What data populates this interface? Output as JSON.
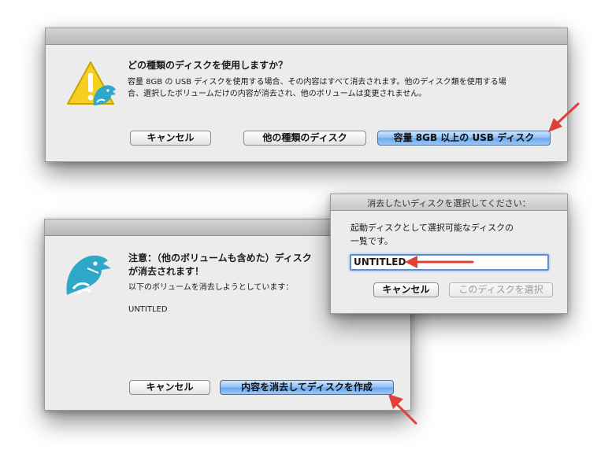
{
  "dialog1": {
    "heading": "どの種類のディスクを使用しますか？",
    "message_line1": "容量 8GB の USB ディスクを使用する場合、その内容はすべて消去されます。他のディスク類を使用する場",
    "message_line2": "合、選択したボリュームだけの内容が消去され、他のボリュームは変更されません。",
    "cancel_label": "キャンセル",
    "other_disk_label": "他の種類のディスク",
    "usb_label": "容量 8GB 以上の USB ディスク"
  },
  "dialog2": {
    "heading_line1": "注意：（他のボリュームも含めた）ディスク",
    "heading_line2": "が消去されます！",
    "message": "以下のボリュームを消去しようとしています：",
    "volume_name": "UNTITLED",
    "cancel_label": "キャンセル",
    "erase_create_label": "内容を消去してディスクを作成"
  },
  "dialog3": {
    "title": "消去したいディスクを選択してください：",
    "instruction_line1": "起動ディスクとして選択可能なディスクの",
    "instruction_line2": "一覧です。",
    "selected_disk": "UNTITLED",
    "cancel_label": "キャンセル",
    "select_label": "このディスクを選択"
  },
  "colors": {
    "warning_yellow": "#f5d020",
    "logo_teal": "#2fa8c8",
    "arrow_red": "#e0403a",
    "default_button_blue": "#6aa6ec"
  }
}
